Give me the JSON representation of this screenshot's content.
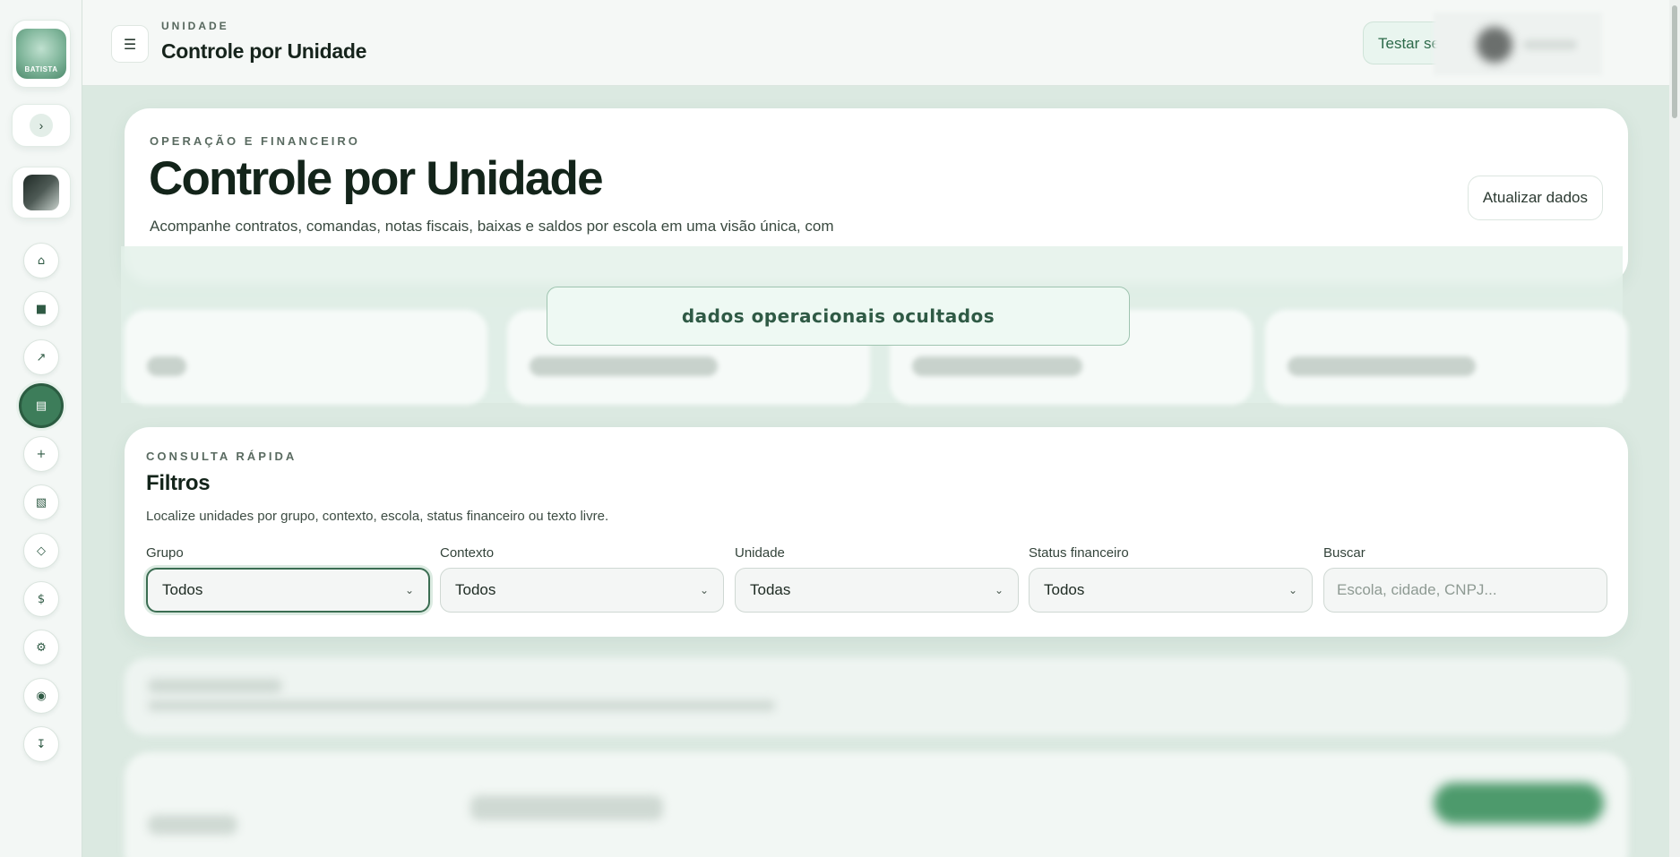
{
  "sidebar": {
    "logo_text": "BATISTA",
    "toggle_icon": "›",
    "nav": [
      {
        "icon": "home-icon",
        "glyph": "⌂",
        "active": false
      },
      {
        "icon": "grid-icon",
        "glyph": "■",
        "active": false
      },
      {
        "icon": "arrow-up-right-icon",
        "glyph": "↗",
        "active": false
      },
      {
        "icon": "document-icon",
        "glyph": "▤",
        "active": true
      },
      {
        "icon": "plus-icon",
        "glyph": "+",
        "active": false
      },
      {
        "icon": "table-icon",
        "glyph": "▧",
        "active": false
      },
      {
        "icon": "diamond-icon",
        "glyph": "◇",
        "active": false
      },
      {
        "icon": "dollar-icon",
        "glyph": "$",
        "active": false
      },
      {
        "icon": "gear-icon",
        "glyph": "⚙",
        "active": false
      },
      {
        "icon": "target-icon",
        "glyph": "◉",
        "active": false
      },
      {
        "icon": "download-icon",
        "glyph": "↧",
        "active": false
      }
    ]
  },
  "topbar": {
    "menu_icon": "☰",
    "eyebrow": "UNIDADE",
    "title": "Controle por Unidade",
    "test_button": "Testar se"
  },
  "hero": {
    "eyebrow": "OPERAÇÃO E FINANCEIRO",
    "title": "Controle por Unidade",
    "description": "Acompanhe contratos, comandas, notas fiscais, baixas e saldos por escola em uma visão única, com",
    "refresh_button": "Atualizar dados"
  },
  "hidden_notice": "dados operacionais ocultados",
  "filters": {
    "eyebrow": "CONSULTA RÁPIDA",
    "title": "Filtros",
    "description": "Localize unidades por grupo, contexto, escola, status financeiro ou texto livre.",
    "fields": [
      {
        "label": "Grupo",
        "value": "Todos"
      },
      {
        "label": "Contexto",
        "value": "Todos"
      },
      {
        "label": "Unidade",
        "value": "Todas"
      },
      {
        "label": "Status financeiro",
        "value": "Todos"
      }
    ],
    "search": {
      "label": "Buscar",
      "placeholder": "Escola, cidade, CNPJ..."
    }
  },
  "colors": {
    "accent": "#3d7d5a",
    "background": "#dbe9e1",
    "notice_text": "#2f5a45"
  }
}
